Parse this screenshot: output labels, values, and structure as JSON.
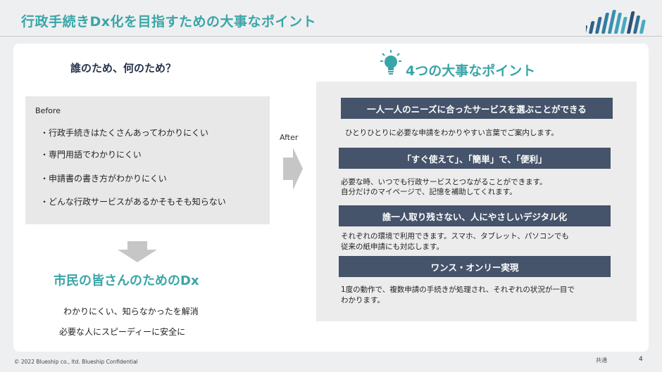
{
  "slide": {
    "title": "行政手続きDx化を目指すための大事なポイント"
  },
  "left": {
    "heading": "誰のため、何のため？",
    "before_label": "Before",
    "before_items": [
      "・行政手続きはたくさんあってわかりにくい",
      "・専門用語でわかりにくい",
      "・申請書の書き方がわかりにくい",
      "・どんな行政サービスがあるかそもそも知らない"
    ],
    "citizen_title": "市民の皆さんのためのDx",
    "citizen_lines": [
      "わかりにくい、知らなかったを解消",
      "必要な人にスピーディーに安全に"
    ]
  },
  "middle": {
    "after_label": "After"
  },
  "right": {
    "heading": "4つの大事なポイント",
    "points": [
      {
        "title": "一人一人のニーズに合ったサービスを選ぶことができる",
        "lines": [
          "ひとりひとりに必要な申請をわかりやすい言葉でご案内します。"
        ]
      },
      {
        "title": "「すぐ使えて」、「簡単」で、「便利」",
        "lines": [
          "必要な時、いつでも行政サービスとつながることができます。",
          "自分だけのマイページで、記憶を補助してくれます。"
        ]
      },
      {
        "title": "誰一人取り残さない、人にやさしいデジタル化",
        "lines": [
          "それぞれの環境で利用できます。スマホ、タブレット、パソコンでも",
          "従来の紙申請にも対応します。"
        ]
      },
      {
        "title": "ワンス・オンリー実現",
        "lines": [
          "1度の動作で、複数申請の手続きが処理され、それぞれの状況が一目で",
          "わかります。"
        ]
      }
    ]
  },
  "footer": {
    "copyright": "© 2022 Blueship co., ltd.     Blueship Confidential",
    "label": "共通",
    "page": "4"
  },
  "colors": {
    "teal": "#3aa5a8",
    "navy_bar": "#45536b",
    "heading_navy": "#26334a"
  }
}
